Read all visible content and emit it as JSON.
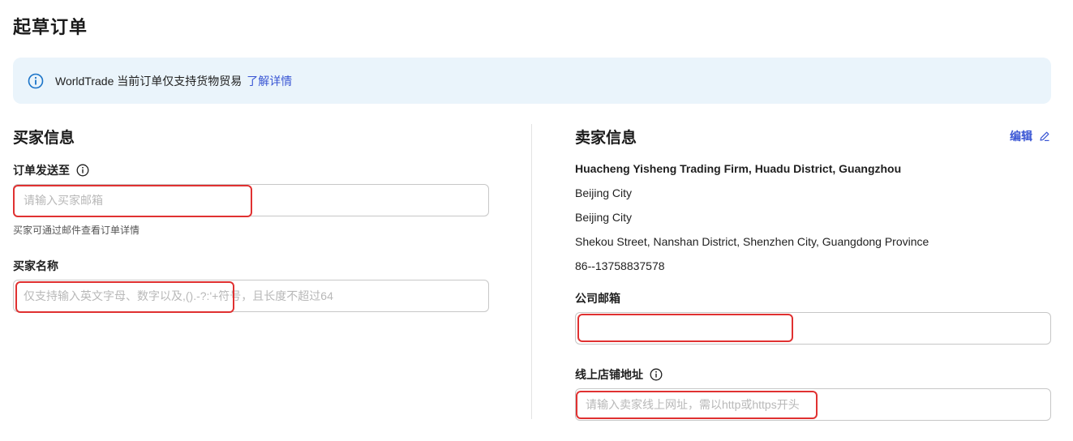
{
  "page": {
    "title": "起草订单"
  },
  "banner": {
    "text": "WorldTrade 当前订单仅支持货物贸易",
    "link": "了解详情"
  },
  "buyer": {
    "section_title": "买家信息",
    "send_to_label": "订单发送至",
    "email_placeholder": "请输入买家邮箱",
    "email_hint": "买家可通过邮件查看订单详情",
    "name_label": "买家名称",
    "name_placeholder": "仅支持输入英文字母、数字以及,().-?:'+符号，且长度不超过64"
  },
  "seller": {
    "section_title": "卖家信息",
    "edit_label": "编辑",
    "company_name": "Huacheng Yisheng Trading Firm, Huadu District, Guangzhou",
    "city": "Beijing City",
    "province": "Beijing City",
    "street": "Shekou Street, Nanshan District, Shenzhen City, Guangdong Province",
    "phone": "86--13758837578",
    "email_label": "公司邮箱",
    "email_value": "",
    "store_label": "线上店铺地址",
    "store_placeholder": "请输入卖家线上网址，需以http或https开头"
  },
  "colors": {
    "accent": "#3a56d4",
    "banner_bg": "#eaf4fb",
    "highlight": "#e03131"
  }
}
